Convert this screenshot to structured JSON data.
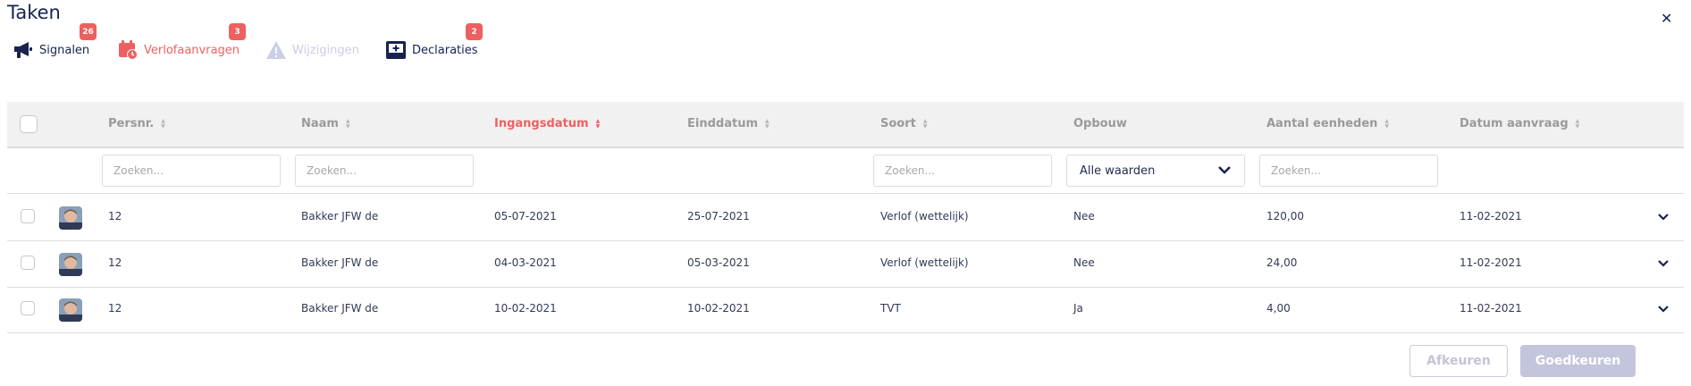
{
  "page": {
    "title": "Taken"
  },
  "close_icon": "close-icon",
  "tabs": [
    {
      "id": "signalen",
      "label": "Signalen",
      "badge": "26",
      "icon": "megaphone-icon",
      "color": "#17234e"
    },
    {
      "id": "verlof",
      "label": "Verlofaanvragen",
      "badge": "3",
      "icon": "calendar-clock-icon",
      "color": "#ee6060",
      "active": true
    },
    {
      "id": "wijzigingen",
      "label": "Wijzigingen",
      "badge": "",
      "icon": "warning-icon",
      "color": "#c9cfe4",
      "disabled": true
    },
    {
      "id": "declaraties",
      "label": "Declaraties",
      "badge": "2",
      "icon": "inbox-plus-icon",
      "color": "#17234e"
    }
  ],
  "table": {
    "columns": [
      {
        "key": "persnr",
        "label": "Persnr.",
        "sortable": true
      },
      {
        "key": "naam",
        "label": "Naam",
        "sortable": true
      },
      {
        "key": "ingangsdatum",
        "label": "Ingangsdatum",
        "sortable": true,
        "active": true
      },
      {
        "key": "einddatum",
        "label": "Einddatum",
        "sortable": true
      },
      {
        "key": "soort",
        "label": "Soort",
        "sortable": true
      },
      {
        "key": "opbouw",
        "label": "Opbouw",
        "sortable": false
      },
      {
        "key": "aantal",
        "label": "Aantal eenheden",
        "sortable": true
      },
      {
        "key": "datum_aanvraag",
        "label": "Datum aanvraag",
        "sortable": true
      }
    ],
    "filters": {
      "search_placeholder": "Zoeken...",
      "opbouw_selected": "Alle waarden"
    },
    "rows": [
      {
        "persnr": "12",
        "naam": "Bakker JFW de",
        "ingangsdatum": "05-07-2021",
        "einddatum": "25-07-2021",
        "soort": "Verlof (wettelijk)",
        "opbouw": "Nee",
        "aantal": "120,00",
        "datum_aanvraag": "11-02-2021"
      },
      {
        "persnr": "12",
        "naam": "Bakker JFW de",
        "ingangsdatum": "04-03-2021",
        "einddatum": "05-03-2021",
        "soort": "Verlof (wettelijk)",
        "opbouw": "Nee",
        "aantal": "24,00",
        "datum_aanvraag": "11-02-2021"
      },
      {
        "persnr": "12",
        "naam": "Bakker JFW de",
        "ingangsdatum": "10-02-2021",
        "einddatum": "10-02-2021",
        "soort": "TVT",
        "opbouw": "Ja",
        "aantal": "4,00",
        "datum_aanvraag": "11-02-2021"
      }
    ]
  },
  "actions": {
    "reject_label": "Afkeuren",
    "approve_label": "Goedkeuren"
  },
  "colors": {
    "accent": "#ee6060",
    "navy": "#17234e",
    "muted": "#9a9a9a",
    "disabled": "#c3c5dc"
  }
}
